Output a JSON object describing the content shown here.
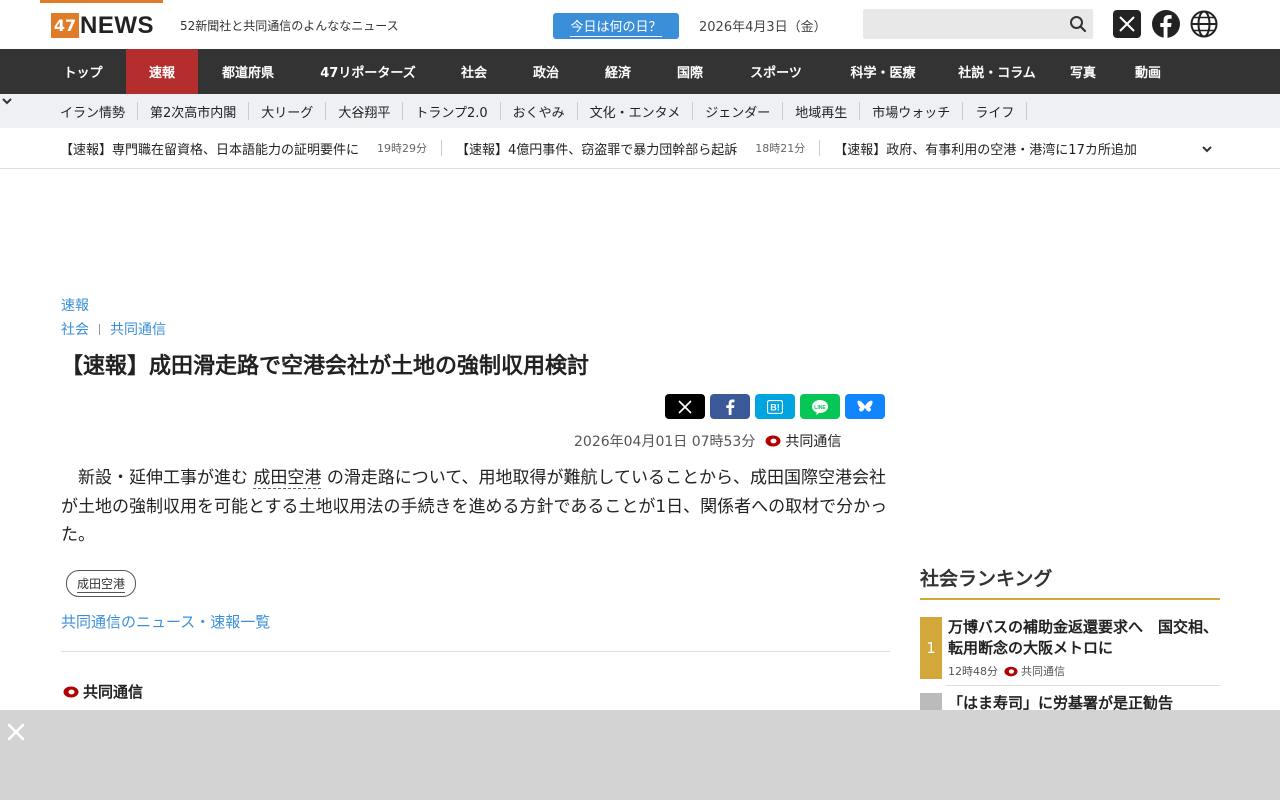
{
  "header": {
    "logo_num": "47",
    "logo_text": "NEWS",
    "tagline": "52新聞社と共同通信のよんななニュース",
    "today_button": "今日は何の日？",
    "date": "2026年4月3日（金）",
    "search_placeholder": ""
  },
  "main_nav": [
    {
      "label": "トップ",
      "active": false
    },
    {
      "label": "速報",
      "active": true
    },
    {
      "label": "都道府県",
      "active": false
    },
    {
      "label": "47リポーターズ",
      "active": false
    },
    {
      "label": "社会",
      "active": false
    },
    {
      "label": "政治",
      "active": false
    },
    {
      "label": "経済",
      "active": false
    },
    {
      "label": "国際",
      "active": false
    },
    {
      "label": "スポーツ",
      "active": false
    },
    {
      "label": "科学・医療",
      "active": false
    },
    {
      "label": "社説・コラム",
      "active": false
    },
    {
      "label": "写真",
      "active": false
    },
    {
      "label": "動画",
      "active": false
    }
  ],
  "sub_nav": [
    "イラン情勢",
    "第2次高市内閣",
    "大リーグ",
    "大谷翔平",
    "トランプ2.0",
    "おくやみ",
    "文化・エンタメ",
    "ジェンダー",
    "地域再生",
    "市場ウォッチ",
    "ライフ"
  ],
  "ticker": [
    {
      "text": "【速報】専門職在留資格、日本語能力の証明要件に",
      "time": "19時29分"
    },
    {
      "text": "【速報】4億円事件、窃盗罪で暴力団幹部ら起訴",
      "time": "18時21分"
    },
    {
      "text": "【速報】政府、有事利用の空港・港湾に17カ所追加",
      "time": ""
    }
  ],
  "article": {
    "category_main": "速報",
    "category": "社会",
    "source_link": "共同通信",
    "headline": "【速報】成田滑走路で空港会社が土地の強制収用検討",
    "datetime": "2026年04月01日 07時53分",
    "source": "共同通信",
    "body_pre": "新設・延伸工事が進む",
    "body_keyword": "成田空港",
    "body_post": "の滑走路について、用地取得が難航していることから、成田国際空港会社が土地の強制収用を可能とする土地収用法の手続きを進める方針であることが1日、関係者への取材で分かった。",
    "tag": "成田空港",
    "more_link": "共同通信のニュース・速報一覧",
    "footer_source": "共同通信"
  },
  "share_buttons": [
    {
      "name": "x",
      "color": "#000000"
    },
    {
      "name": "facebook",
      "color": "#3b5998"
    },
    {
      "name": "hatena",
      "color": "#00a4de"
    },
    {
      "name": "line",
      "color": "#06c755"
    },
    {
      "name": "bluesky",
      "color": "#1185fe"
    }
  ],
  "ranking": {
    "title": "社会ランキング",
    "items": [
      {
        "rank": "1",
        "headline": "万博バスの補助金返還要求へ　国交相、転用断念の大阪メトロに",
        "time": "12時48分",
        "source": "共同通信",
        "color": "#d4a73a"
      },
      {
        "rank": "",
        "headline": "「はま寿司」に労基署が是正勧告",
        "time": "",
        "source": "",
        "color": "#bbbbbb"
      }
    ]
  },
  "colors": {
    "accent": "#e07b2a",
    "link": "#3b8fd9",
    "active_nav": "#b52e2e",
    "nav_bg": "#333333"
  }
}
